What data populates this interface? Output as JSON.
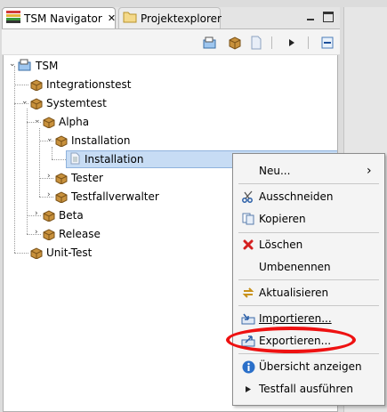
{
  "tabs": [
    {
      "label": "TSM Navigator",
      "icon": "tsm-navigator-icon",
      "close": "✕"
    },
    {
      "label": "Projektexplorer",
      "icon": "folder-icon"
    }
  ],
  "toolbar": {
    "icons": [
      "new-project-icon",
      "package-icon",
      "document-icon",
      "arrow-right-icon",
      "collapse-all-icon"
    ]
  },
  "tree": [
    {
      "label": "TSM",
      "icon": "tsm-project-icon",
      "expanded": true,
      "depth": 0
    },
    {
      "label": "Integrationstest",
      "icon": "package-icon",
      "depth": 1
    },
    {
      "label": "Systemtest",
      "icon": "package-icon",
      "expanded": true,
      "depth": 1
    },
    {
      "label": "Alpha",
      "icon": "package-icon",
      "expanded": true,
      "depth": 2
    },
    {
      "label": "Installation",
      "icon": "package-icon",
      "expanded": true,
      "depth": 3
    },
    {
      "label": "Installation",
      "icon": "document-icon",
      "depth": 4,
      "selected": true
    },
    {
      "label": "Tester",
      "icon": "package-icon",
      "collapsed": true,
      "depth": 3
    },
    {
      "label": "Testfallverwalter",
      "icon": "package-icon",
      "collapsed": true,
      "depth": 3
    },
    {
      "label": "Beta",
      "icon": "package-icon",
      "collapsed": true,
      "depth": 2
    },
    {
      "label": "Release",
      "icon": "package-icon",
      "collapsed": true,
      "depth": 2
    },
    {
      "label": "Unit-Test",
      "icon": "package-icon",
      "depth": 1
    }
  ],
  "context_menu": {
    "items": [
      {
        "label": "Neu...",
        "submenu": "›",
        "icon": ""
      },
      {
        "label": "Ausschneiden",
        "icon": "scissors-icon"
      },
      {
        "label": "Kopieren",
        "icon": "copy-icon"
      },
      {
        "label": "Löschen",
        "icon": "delete-icon"
      },
      {
        "label": "Umbenennen",
        "icon": ""
      },
      {
        "label": "Aktualisieren",
        "icon": "refresh-icon"
      },
      {
        "label": "Importieren...",
        "icon": "import-icon"
      },
      {
        "label": "Exportieren...",
        "icon": "export-icon"
      },
      {
        "label": "Übersicht anzeigen",
        "icon": "info-icon"
      },
      {
        "label": "Testfall ausführen",
        "icon": "play-icon"
      }
    ]
  },
  "colors": {
    "selection": "#c7dcf4",
    "highlight_ellipse": "#ee1111",
    "package": "#b07a2a",
    "info": "#2a6fc9",
    "delete": "#d42020"
  }
}
